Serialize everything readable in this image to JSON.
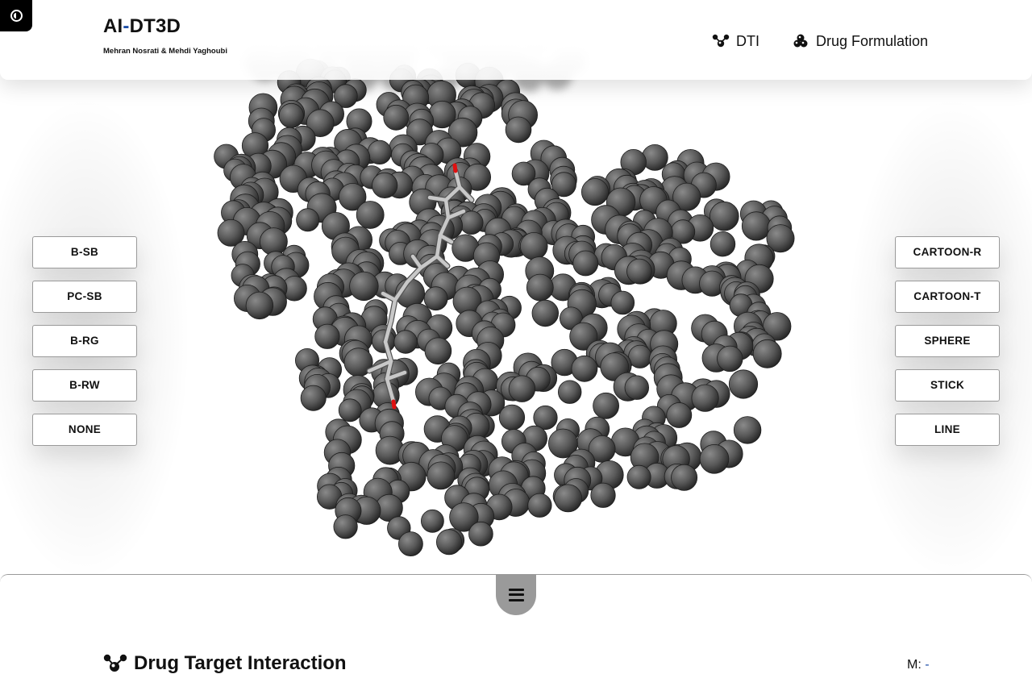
{
  "header": {
    "title_prefix": "AI",
    "title_dash": "-",
    "title_suffix": "DT3D",
    "authors": "Mehran Nosrati & Mehdi Yaghoubi",
    "nav": [
      {
        "label": "DTI",
        "icon": "molecule-icon"
      },
      {
        "label": "Drug Formulation",
        "icon": "molecule-cluster-icon"
      }
    ]
  },
  "theme_toggle": {
    "icon": "contrast-icon"
  },
  "left_buttons": [
    "B-SB",
    "PC-SB",
    "B-RG",
    "B-RW",
    "NONE"
  ],
  "right_buttons": [
    "CARTOON-R",
    "CARTOON-T",
    "SPHERE",
    "STICK",
    "LINE"
  ],
  "viewer": {
    "style": "sphere",
    "colors": {
      "protein": "#5a5a5a",
      "ligand": "#c8c8c8",
      "oxygen": "#e01010"
    }
  },
  "bottom": {
    "menu_icon": "hamburger-icon",
    "section_title": "Drug Target Interaction",
    "section_icon": "molecule-icon",
    "metric_label": "M:",
    "metric_value": "-"
  },
  "colors": {
    "accent": "#1d4ea8",
    "panel_tab": "#9a9a9a"
  }
}
